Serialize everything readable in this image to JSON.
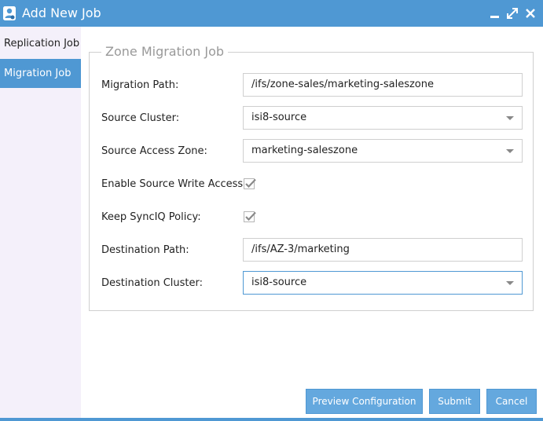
{
  "window": {
    "title": "Add New Job",
    "icon": "user-gear-icon",
    "controls": [
      "minimize-icon",
      "maximize-icon",
      "close-icon"
    ],
    "accent_color": "#4f98d3"
  },
  "sidebar": {
    "items": [
      {
        "label": "Replication Job",
        "active": false
      },
      {
        "label": "Migration Job",
        "active": true
      }
    ]
  },
  "form": {
    "legend": "Zone Migration Job",
    "migration_path": {
      "label": "Migration Path:",
      "value": "/ifs/zone-sales/marketing-saleszone"
    },
    "source_cluster": {
      "label": "Source Cluster:",
      "value": "isi8-source"
    },
    "source_access_zone": {
      "label": "Source Access Zone:",
      "value": "marketing-saleszone"
    },
    "enable_source_write_access": {
      "label": "Enable Source Write Access:",
      "checked": true
    },
    "keep_synciq_policy": {
      "label": "Keep SyncIQ Policy:",
      "checked": true
    },
    "destination_path": {
      "label": "Destination Path:",
      "value": "/ifs/AZ-3/marketing"
    },
    "destination_cluster": {
      "label": "Destination Cluster:",
      "value": "isi8-source"
    }
  },
  "buttons": {
    "preview": "Preview Configuration",
    "submit": "Submit",
    "cancel": "Cancel"
  }
}
